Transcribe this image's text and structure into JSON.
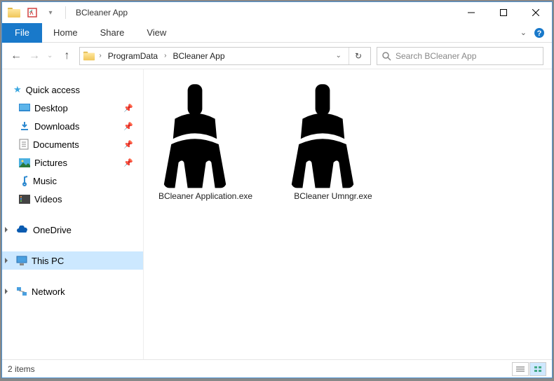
{
  "window": {
    "title": "BCleaner App"
  },
  "ribbon": {
    "file": "File",
    "tabs": [
      "Home",
      "Share",
      "View"
    ]
  },
  "address": {
    "crumbs": [
      "ProgramData",
      "BCleaner App"
    ]
  },
  "search": {
    "placeholder": "Search BCleaner App"
  },
  "nav": {
    "quick_access": {
      "label": "Quick access"
    },
    "items": [
      {
        "label": "Desktop",
        "pinned": true
      },
      {
        "label": "Downloads",
        "pinned": true
      },
      {
        "label": "Documents",
        "pinned": true
      },
      {
        "label": "Pictures",
        "pinned": true
      },
      {
        "label": "Music",
        "pinned": false
      },
      {
        "label": "Videos",
        "pinned": false
      }
    ],
    "onedrive": {
      "label": "OneDrive"
    },
    "this_pc": {
      "label": "This PC"
    },
    "network": {
      "label": "Network"
    }
  },
  "files": [
    {
      "name": "BCleaner Application.exe"
    },
    {
      "name": "BCleaner Umngr.exe"
    }
  ],
  "status": {
    "text": "2 items"
  }
}
